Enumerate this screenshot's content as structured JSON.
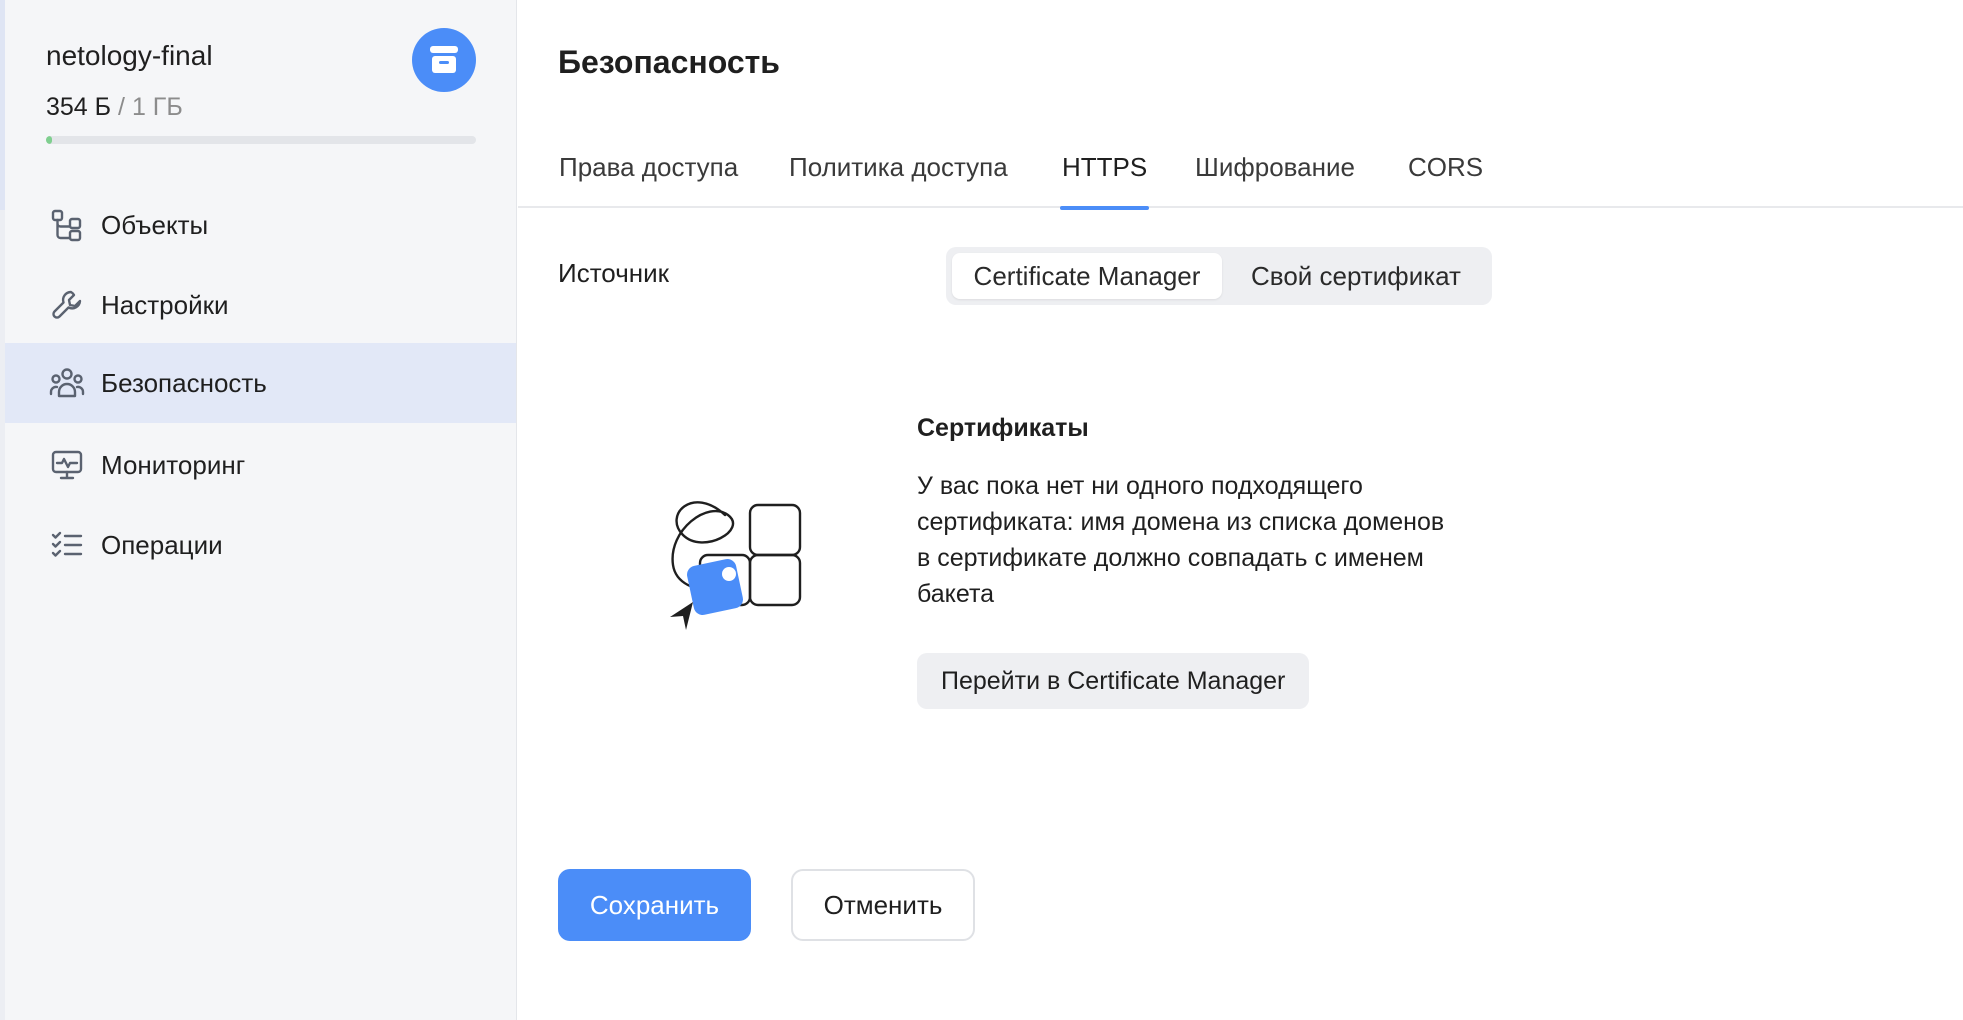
{
  "bucket": {
    "name": "netology-final",
    "used": "354 Б",
    "separator": "/",
    "total": "1 ГБ",
    "usage_fraction": 0.01,
    "icon": "bucket-icon"
  },
  "sidebar": {
    "items": [
      {
        "label": "Объекты",
        "icon": "objects-icon",
        "active": false
      },
      {
        "label": "Настройки",
        "icon": "wrench-icon",
        "active": false
      },
      {
        "label": "Безопасность",
        "icon": "users-icon",
        "active": true
      },
      {
        "label": "Мониторинг",
        "icon": "monitor-icon",
        "active": false
      },
      {
        "label": "Операции",
        "icon": "checklist-icon",
        "active": false
      }
    ]
  },
  "main": {
    "title": "Безопасность",
    "tabs": [
      {
        "label": "Права доступа",
        "active": false
      },
      {
        "label": "Политика доступа",
        "active": false
      },
      {
        "label": "HTTPS",
        "active": true
      },
      {
        "label": "Шифрование",
        "active": false
      },
      {
        "label": "CORS",
        "active": false
      }
    ],
    "source": {
      "label": "Источник",
      "options": [
        {
          "label": "Certificate Manager",
          "selected": true
        },
        {
          "label": "Свой сертификат",
          "selected": false
        }
      ]
    },
    "certificates": {
      "title": "Сертификаты",
      "description": "У вас пока нет ни одного подходящего сертификата: имя домена из списка доменов в сертификате должно совпадать с именем бакета",
      "goto_label": "Перейти в Certificate Manager"
    },
    "actions": {
      "save_label": "Сохранить",
      "cancel_label": "Отменить"
    }
  },
  "colors": {
    "accent": "#4b8df8",
    "active_nav_bg": "#e2e8f7",
    "usage_fill": "#7fcf8f"
  }
}
